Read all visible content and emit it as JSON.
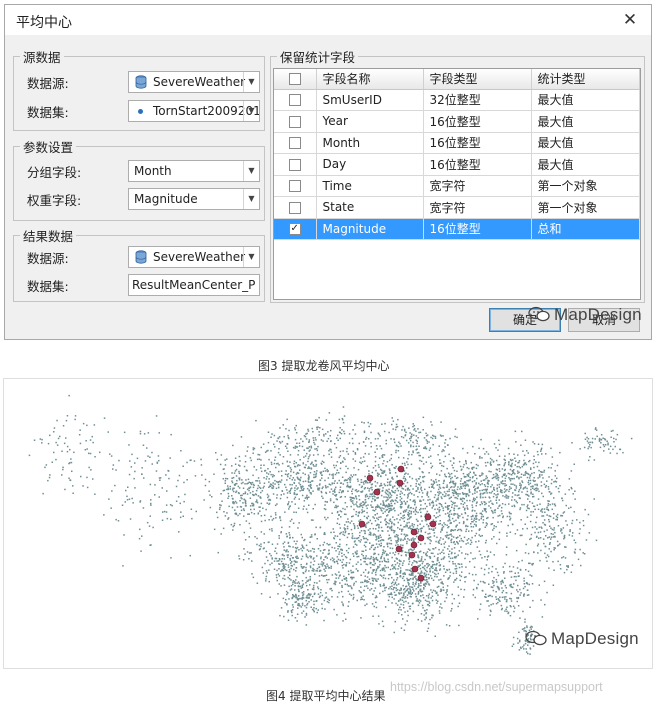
{
  "dialog": {
    "title": "平均中心",
    "close_glyph": "✕",
    "source_group": {
      "legend": "源数据",
      "datasource_label": "数据源:",
      "datasource_value": "SevereWeather",
      "dataset_label": "数据集:",
      "dataset_value": "TornStart2009201"
    },
    "param_group": {
      "legend": "参数设置",
      "group_field_label": "分组字段:",
      "group_field_value": "Month",
      "weight_field_label": "权重字段:",
      "weight_field_value": "Magnitude"
    },
    "result_group": {
      "legend": "结果数据",
      "datasource_label": "数据源:",
      "datasource_value": "SevereWeather",
      "dataset_label": "数据集:",
      "dataset_value": "ResultMeanCenter_P"
    },
    "stats_group": {
      "legend": "保留统计字段",
      "columns": [
        "字段名称",
        "字段类型",
        "统计类型"
      ],
      "rows": [
        {
          "name": "SmUserID",
          "type": "32位整型",
          "stat": "最大值",
          "checked": false
        },
        {
          "name": "Year",
          "type": "16位整型",
          "stat": "最大值",
          "checked": false
        },
        {
          "name": "Month",
          "type": "16位整型",
          "stat": "最大值",
          "checked": false
        },
        {
          "name": "Day",
          "type": "16位整型",
          "stat": "最大值",
          "checked": false
        },
        {
          "name": "Time",
          "type": "宽字符",
          "stat": "第一个对象",
          "checked": false
        },
        {
          "name": "State",
          "type": "宽字符",
          "stat": "第一个对象",
          "checked": false
        },
        {
          "name": "Magnitude",
          "type": "16位整型",
          "stat": "总和",
          "checked": true
        }
      ]
    },
    "ok_label": "确定",
    "cancel_label": "取消"
  },
  "watermark_text": "MapDesign",
  "caption_fig3": "图3 提取龙卷风平均中心",
  "caption_fig4": "图4 提取平均中心结果",
  "csdn_url": "https://blog.csdn.net/supermapsupport",
  "colors": {
    "point": "#6f8f93",
    "center": "#a3324d",
    "selection": "#3399ff"
  }
}
